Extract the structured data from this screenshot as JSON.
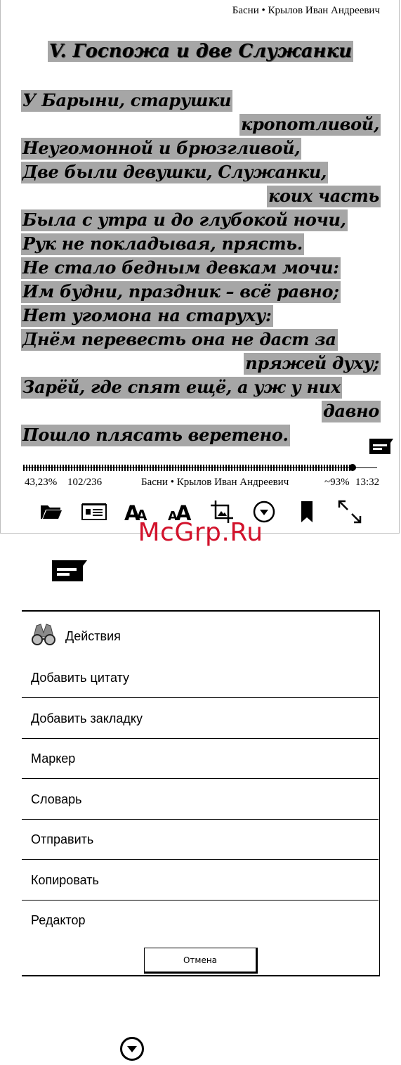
{
  "running_head": "Басни • Крылов Иван Андреевич",
  "chapter_title": "V. Госпожа и две Служанки",
  "poem_lines": [
    {
      "text": "У Барыни, старушки",
      "align": "left"
    },
    {
      "text": "кропотливой,",
      "align": "right"
    },
    {
      "text": "Неугомонной и брюзгливой,",
      "align": "left"
    },
    {
      "text": "Две были девушки, Служанки,",
      "align": "left"
    },
    {
      "text": "коих часть",
      "align": "right"
    },
    {
      "text": "Была с утра и до глубокой ночи,",
      "align": "left"
    },
    {
      "text": "Рук не покладывая, прясть.",
      "align": "left"
    },
    {
      "text": "Не стало бедным девкам мочи:",
      "align": "left"
    },
    {
      "text": "Им будни, праздник – всё равно;",
      "align": "left"
    },
    {
      "text": "Нет угомона на старуху:",
      "align": "left"
    },
    {
      "text": "Днём перевесть она не даст за",
      "align": "left"
    },
    {
      "text": "пряжей духу;",
      "align": "right"
    },
    {
      "text": "Зарёй, где спят ещё, а уж у них",
      "align": "left"
    },
    {
      "text": "давно",
      "align": "right"
    },
    {
      "text": "Пошло плясать веретено.",
      "align": "left"
    }
  ],
  "status": {
    "percent": "43,23%",
    "pages": "102/236",
    "book": "Басни • Крылов Иван Андреевич",
    "battery": "~93%",
    "time": "13:32"
  },
  "progress_fraction": 0.93,
  "toolbar_icons": [
    "folder-icon",
    "contents-icon",
    "font-size-icon",
    "font-style-icon",
    "crop-icon",
    "dropdown-icon",
    "bookmark-icon",
    "fullscreen-icon"
  ],
  "watermark": "McGrp.Ru",
  "dialog": {
    "title": "Действия",
    "items": [
      "Добавить цитату",
      "Добавить закладку",
      "Маркер",
      "Словарь",
      "Отправить",
      "Копировать",
      "Редактор"
    ],
    "cancel_label": "Отмена"
  },
  "colors": {
    "highlight": "#a6a6a6",
    "watermark": "#d2122b"
  }
}
